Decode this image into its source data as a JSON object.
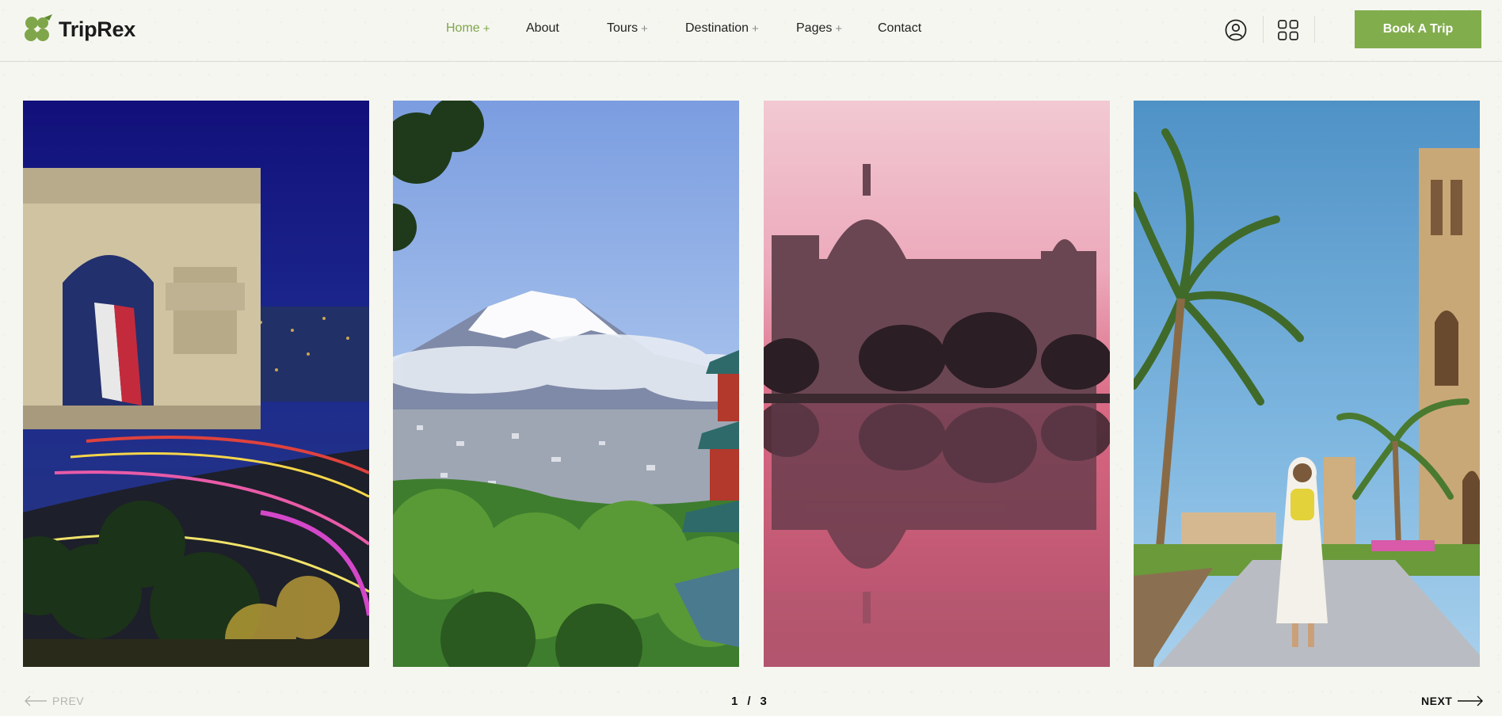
{
  "brand": {
    "name": "TripRex",
    "accent": "#82ad4d"
  },
  "nav": {
    "items": [
      {
        "label": "Home",
        "has_submenu": true,
        "active": true
      },
      {
        "label": "About",
        "has_submenu": false
      },
      {
        "label": "Tours",
        "has_submenu": true
      },
      {
        "label": "Destination",
        "has_submenu": true
      },
      {
        "label": "Pages",
        "has_submenu": true
      },
      {
        "label": "Contact",
        "has_submenu": false
      }
    ],
    "plus": "+"
  },
  "header_actions": {
    "user_icon": "user-circle-icon",
    "grid_icon": "grid-menu-icon",
    "book_label": "Book A Trip"
  },
  "slider": {
    "cards": [
      {
        "image": "arc-de-triomphe-night"
      },
      {
        "image": "mount-fuji"
      },
      {
        "image": "victoria-memorial-reflection"
      },
      {
        "image": "dubai-palm-walkway"
      }
    ],
    "prev_label": "PREV",
    "next_label": "NEXT",
    "current": "1",
    "separator": "/",
    "total": "3"
  }
}
